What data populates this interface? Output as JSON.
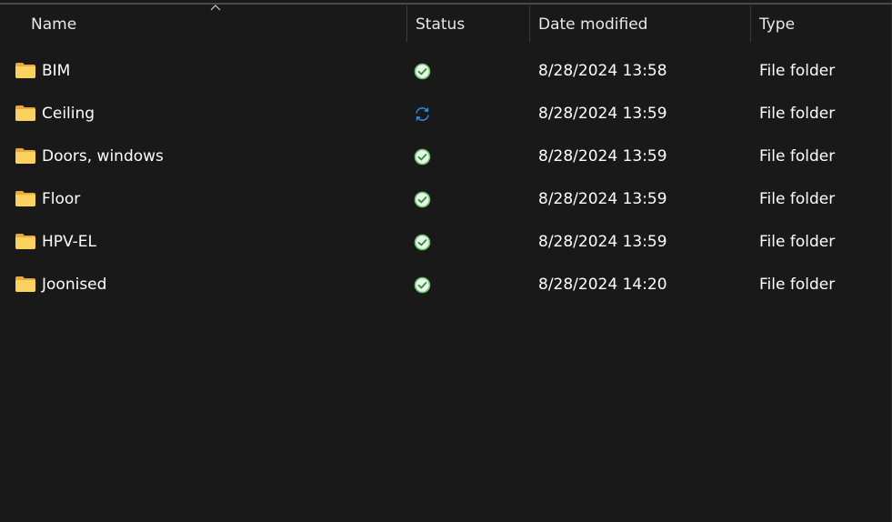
{
  "columns": {
    "name": "Name",
    "status": "Status",
    "date": "Date modified",
    "type": "Type"
  },
  "sort": {
    "column": "name",
    "direction": "ascending",
    "indicator_icon": "chevron-up-icon"
  },
  "files": [
    {
      "name": "BIM",
      "status": "synced",
      "status_icon": "check-circle-icon",
      "date": "8/28/2024 13:58",
      "type": "File folder"
    },
    {
      "name": "Ceiling",
      "status": "syncing",
      "status_icon": "sync-icon",
      "date": "8/28/2024 13:59",
      "type": "File folder"
    },
    {
      "name": "Doors, windows",
      "status": "synced",
      "status_icon": "check-circle-icon",
      "date": "8/28/2024 13:59",
      "type": "File folder"
    },
    {
      "name": "Floor",
      "status": "synced",
      "status_icon": "check-circle-icon",
      "date": "8/28/2024 13:59",
      "type": "File folder"
    },
    {
      "name": "HPV-EL",
      "status": "synced",
      "status_icon": "check-circle-icon",
      "date": "8/28/2024 13:59",
      "type": "File folder"
    },
    {
      "name": "Joonised",
      "status": "synced",
      "status_icon": "check-circle-icon",
      "date": "8/28/2024 14:20",
      "type": "File folder"
    }
  ],
  "colors": {
    "background": "#191919",
    "text": "#ffffff",
    "folder": "#f8c64a",
    "synced": "#6cc26c",
    "syncing": "#2f8ee5",
    "divider": "#3c3c3c"
  }
}
